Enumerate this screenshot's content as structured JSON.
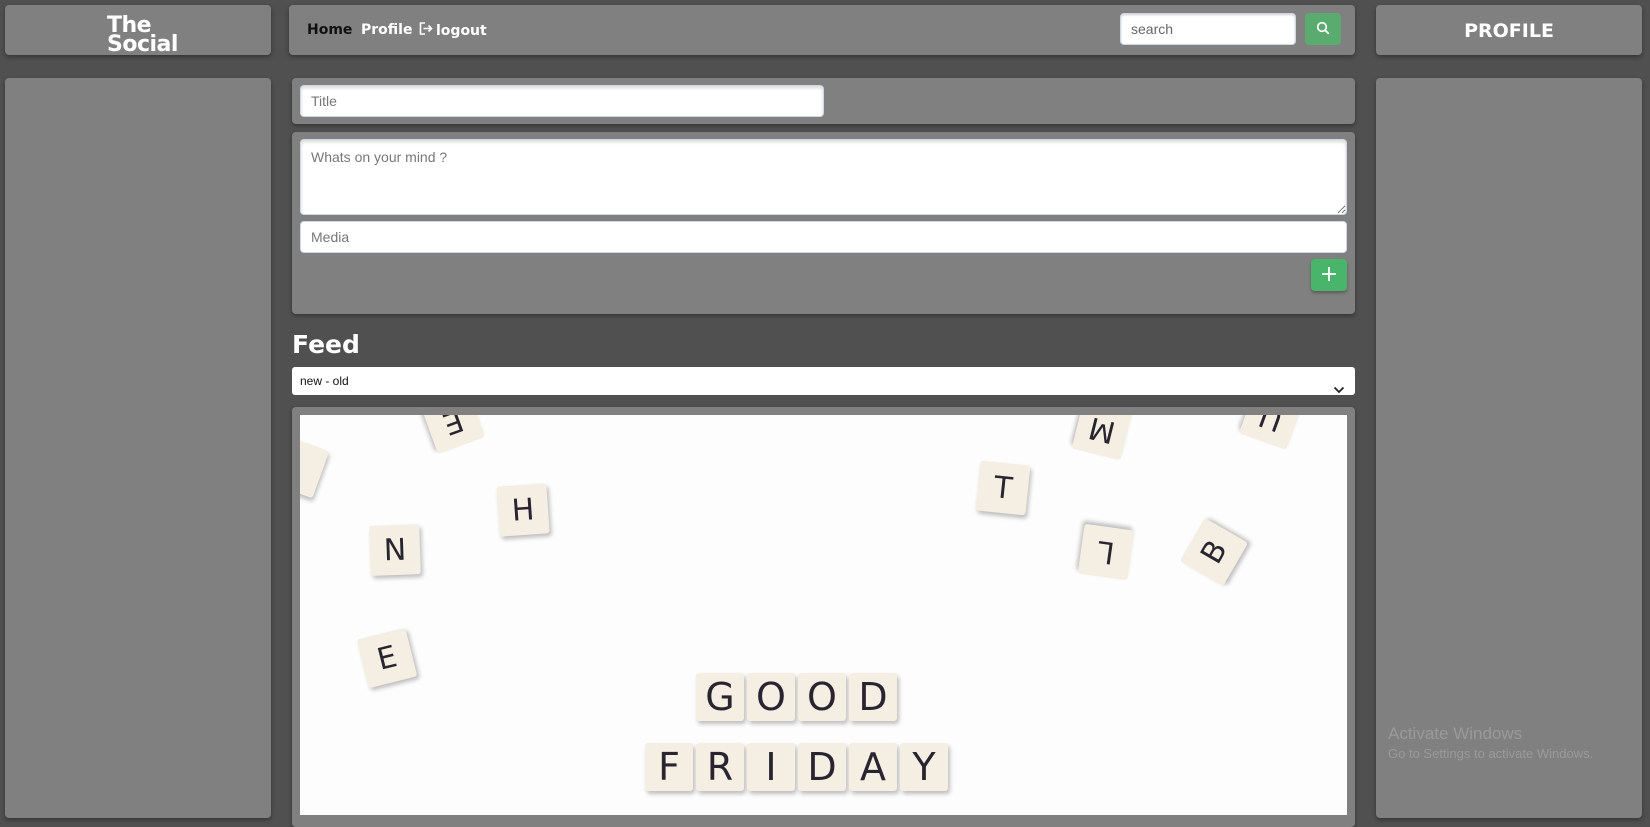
{
  "logo": {
    "line1": "The",
    "line2": "Social"
  },
  "nav": {
    "home": "Home",
    "profile": "Profile",
    "logout": "logout",
    "logout_icon": "logout-arrow-icon"
  },
  "search": {
    "placeholder": "search",
    "value": "",
    "icon": "search-icon"
  },
  "profile_panel": {
    "title": "PROFILE"
  },
  "composer": {
    "title_placeholder": "Title",
    "body_placeholder": "Whats on your mind ?",
    "media_placeholder": "Media",
    "add_label": "+"
  },
  "feed": {
    "heading": "Feed",
    "sort_selected": "new - old",
    "post_image": {
      "scattered_letters": [
        "E",
        "H",
        "N",
        "E",
        "T",
        "M",
        "L",
        "B",
        "U"
      ],
      "word1": [
        "G",
        "O",
        "O",
        "D"
      ],
      "word2": [
        "F",
        "R",
        "I",
        "D",
        "A",
        "Y"
      ]
    }
  },
  "watermark": {
    "title": "Activate Windows",
    "subtitle": "Go to Settings to activate Windows."
  },
  "colors": {
    "background": "#505050",
    "panel": "#808080",
    "accent_green": "#48b56a"
  }
}
